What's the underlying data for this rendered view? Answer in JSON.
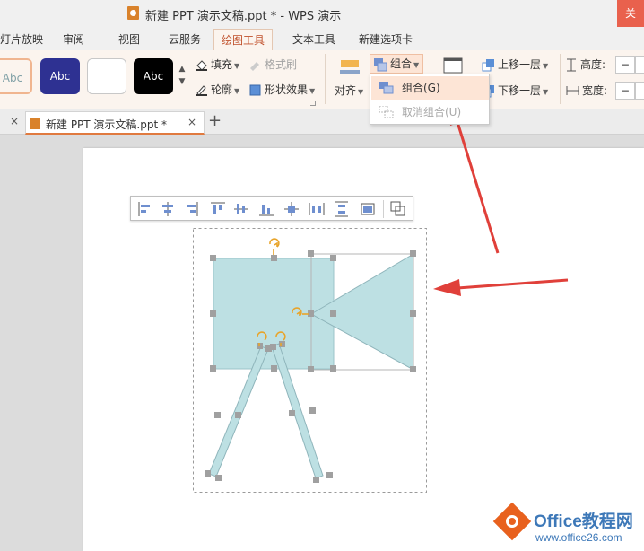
{
  "window": {
    "title": "新建 PPT 演示文稿.ppt * - WPS 演示",
    "close_label": "关"
  },
  "tabs": [
    {
      "label": "灯片放映"
    },
    {
      "label": "审阅"
    },
    {
      "label": "视图"
    },
    {
      "label": "云服务"
    },
    {
      "label": "绘图工具"
    },
    {
      "label": "文本工具"
    },
    {
      "label": "新建选项卡"
    }
  ],
  "ribbon": {
    "styles": [
      {
        "label": "Abc",
        "bg": "#b7e1e6",
        "fg": "#7fa0a6"
      },
      {
        "label": "Abc",
        "bg": "#2e3192",
        "fg": "#ffffff"
      },
      {
        "label": "",
        "bg": "#ffffff",
        "fg": "#333333"
      },
      {
        "label": "Abc",
        "bg": "#000000",
        "fg": "#ffffff"
      }
    ],
    "fill_label": "填充",
    "format_painter_label": "格式刷",
    "outline_label": "轮廓",
    "shape_effect_label": "形状效果",
    "align_label": "对齐",
    "group_label": "组合",
    "bring_forward_label": "上移一层",
    "send_backward_label": "下移一层",
    "height_label": "高度:",
    "width_label": "宽度:",
    "stepper_minus": "−"
  },
  "group_menu": {
    "items": [
      {
        "label": "组合(G)",
        "state": "hover"
      },
      {
        "label": "取消组合(U)",
        "state": "disabled"
      }
    ]
  },
  "document_tab": {
    "name": "新建 PPT 演示文稿.ppt *",
    "close": "×",
    "new_tab": "+"
  },
  "align_toolbar": {
    "icons": [
      "align-left-icon",
      "align-center-icon",
      "align-right-icon",
      "align-top-icon",
      "align-middle-icon",
      "align-bottom-icon",
      "center-on-slide-icon",
      "distribute-horizontal-icon",
      "distribute-vertical-icon",
      "fit-slide-icon",
      "group-objects-icon"
    ]
  },
  "colors": {
    "accent": "#c0502b",
    "shape_fill": "#bde0e3",
    "shape_stroke": "#8fb5bb",
    "handle": "#a0a0a0",
    "rotate_handle": "#e8a42a",
    "arrow": "#e0403a"
  },
  "watermark": {
    "brand": "Office教程网",
    "url": "www.office26.com"
  }
}
